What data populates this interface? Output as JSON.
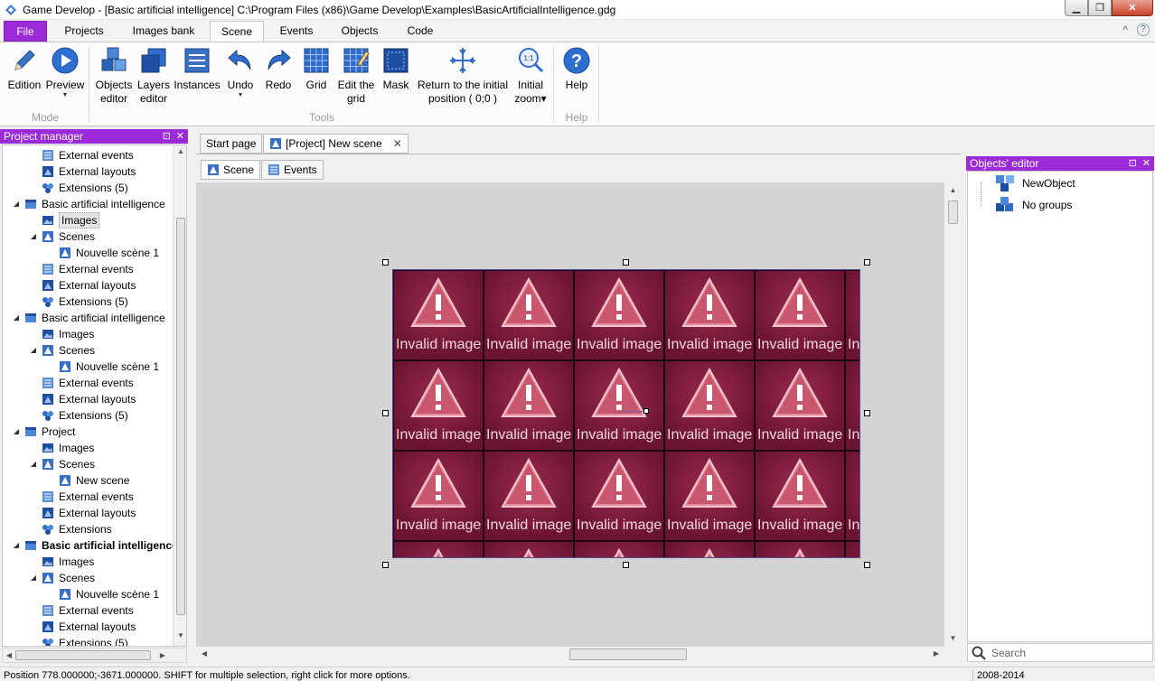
{
  "window": {
    "title": "Game Develop - [Basic artificial intelligence] C:\\Program Files (x86)\\Game Develop\\Examples\\BasicArtificialIntelligence.gdg",
    "min_label": "▁",
    "max_label": "❐",
    "close_label": "✕"
  },
  "ribbon_tabs": [
    "File",
    "Projects",
    "Images bank",
    "Scene",
    "Events",
    "Objects",
    "Code"
  ],
  "ribbon_right": {
    "collapse": "^",
    "help": "?"
  },
  "ribbon": {
    "buttons": [
      {
        "label": "Edition",
        "label2": ""
      },
      {
        "label": "Preview",
        "label2": ""
      },
      {
        "label": "Objects",
        "label2": "editor"
      },
      {
        "label": "Layers",
        "label2": "editor"
      },
      {
        "label": "Instances",
        "label2": ""
      },
      {
        "label": "Undo",
        "label2": ""
      },
      {
        "label": "Redo",
        "label2": ""
      },
      {
        "label": "Grid",
        "label2": ""
      },
      {
        "label": "Edit the",
        "label2": "grid"
      },
      {
        "label": "Mask",
        "label2": ""
      },
      {
        "label": "Return to the initial",
        "label2": "position ( 0;0 )"
      },
      {
        "label": "Initial",
        "label2": "zoom▾"
      },
      {
        "label": "Help",
        "label2": ""
      }
    ],
    "groups": [
      "Mode",
      "Tools",
      "Help"
    ]
  },
  "project_manager": {
    "title": "Project manager",
    "pin": "⊡",
    "close": "✕",
    "items": [
      {
        "label": "External events",
        "level": 2,
        "icon": "events",
        "expander": ""
      },
      {
        "label": "External layouts",
        "level": 2,
        "icon": "layouts",
        "expander": ""
      },
      {
        "label": "Extensions (5)",
        "level": 2,
        "icon": "extensions",
        "expander": ""
      },
      {
        "label": "Basic artificial intelligence",
        "level": 1,
        "icon": "project",
        "expander": "◢"
      },
      {
        "label": "Images",
        "level": 2,
        "icon": "images",
        "expander": "",
        "selected": true
      },
      {
        "label": "Scenes",
        "level": 2,
        "icon": "scenes",
        "expander": "◢"
      },
      {
        "label": "Nouvelle scène 1",
        "level": 3,
        "icon": "scene",
        "expander": ""
      },
      {
        "label": "External events",
        "level": 2,
        "icon": "events",
        "expander": ""
      },
      {
        "label": "External layouts",
        "level": 2,
        "icon": "layouts",
        "expander": ""
      },
      {
        "label": "Extensions (5)",
        "level": 2,
        "icon": "extensions",
        "expander": ""
      },
      {
        "label": "Basic artificial intelligence",
        "level": 1,
        "icon": "project",
        "expander": "◢"
      },
      {
        "label": "Images",
        "level": 2,
        "icon": "images",
        "expander": ""
      },
      {
        "label": "Scenes",
        "level": 2,
        "icon": "scenes",
        "expander": "◢"
      },
      {
        "label": "Nouvelle scène 1",
        "level": 3,
        "icon": "scene",
        "expander": ""
      },
      {
        "label": "External events",
        "level": 2,
        "icon": "events",
        "expander": ""
      },
      {
        "label": "External layouts",
        "level": 2,
        "icon": "layouts",
        "expander": ""
      },
      {
        "label": "Extensions (5)",
        "level": 2,
        "icon": "extensions",
        "expander": ""
      },
      {
        "label": "Project",
        "level": 1,
        "icon": "project",
        "expander": "◢"
      },
      {
        "label": "Images",
        "level": 2,
        "icon": "images",
        "expander": ""
      },
      {
        "label": "Scenes",
        "level": 2,
        "icon": "scenes",
        "expander": "◢"
      },
      {
        "label": "New scene",
        "level": 3,
        "icon": "scene",
        "expander": ""
      },
      {
        "label": "External events",
        "level": 2,
        "icon": "events",
        "expander": ""
      },
      {
        "label": "External layouts",
        "level": 2,
        "icon": "layouts",
        "expander": ""
      },
      {
        "label": "Extensions",
        "level": 2,
        "icon": "extensions",
        "expander": ""
      },
      {
        "label": "Basic artificial intelligence",
        "level": 1,
        "icon": "project",
        "expander": "◢",
        "bold": true
      },
      {
        "label": "Images",
        "level": 2,
        "icon": "images",
        "expander": ""
      },
      {
        "label": "Scenes",
        "level": 2,
        "icon": "scenes",
        "expander": "◢"
      },
      {
        "label": "Nouvelle scène 1",
        "level": 3,
        "icon": "scene",
        "expander": ""
      },
      {
        "label": "External events",
        "level": 2,
        "icon": "events",
        "expander": ""
      },
      {
        "label": "External layouts",
        "level": 2,
        "icon": "layouts",
        "expander": ""
      },
      {
        "label": "Extensions (5)",
        "level": 2,
        "icon": "extensions",
        "expander": ""
      }
    ]
  },
  "doc_tabs": {
    "start_page": "Start page",
    "new_scene": "[Project] New scene",
    "close": "✕"
  },
  "sub_tabs": {
    "scene": "Scene",
    "events": "Events"
  },
  "scene": {
    "tile_label": "Invalid image",
    "colors": {
      "tile": "#7a1a3c",
      "background": "#d4d4d4",
      "selection": "#5a4a8a"
    }
  },
  "objects_editor": {
    "title": "Objects' editor",
    "pin": "⊡",
    "close": "✕",
    "items": [
      "NewObject",
      "No groups"
    ]
  },
  "search": {
    "placeholder": "Search"
  },
  "status": {
    "message": "Position 778.000000;-3671.000000. SHIFT for multiple selection, right click for more options.",
    "copyright": "2008-2014"
  }
}
